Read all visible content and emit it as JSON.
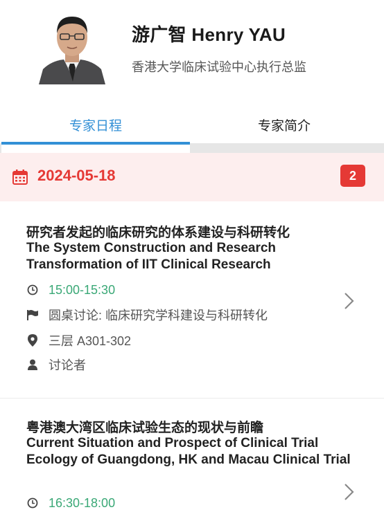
{
  "profile": {
    "name": "游广智 Henry YAU",
    "role": "香港大学临床试验中心执行总监"
  },
  "tabs": [
    {
      "label": "专家日程",
      "active": true
    },
    {
      "label": "专家简介",
      "active": false
    }
  ],
  "schedule": {
    "date": "2024-05-18",
    "count": "2",
    "icon": "calendar-icon"
  },
  "sessions": [
    {
      "title_cn": "研究者发起的临床研究的体系建设与科研转化",
      "title_en": "The System Construction and Research Transformation of IIT Clinical Research",
      "time": "15:00-15:30",
      "session": "圆桌讨论: 临床研究学科建设与科研转化",
      "location": "三层 A301-302",
      "role": "讨论者"
    },
    {
      "title_cn": "粤港澳大湾区临床试验生态的现状与前瞻",
      "title_en": "Current Situation and Prospect of Clinical Trial Ecology of Guangdong, HK and Macau Clinical Trial",
      "time": "16:30-18:00"
    }
  ],
  "colors": {
    "accent_blue": "#3390d6",
    "date_red": "#e53935",
    "time_green": "#3aa876",
    "date_bar_bg": "#fdeeee"
  }
}
